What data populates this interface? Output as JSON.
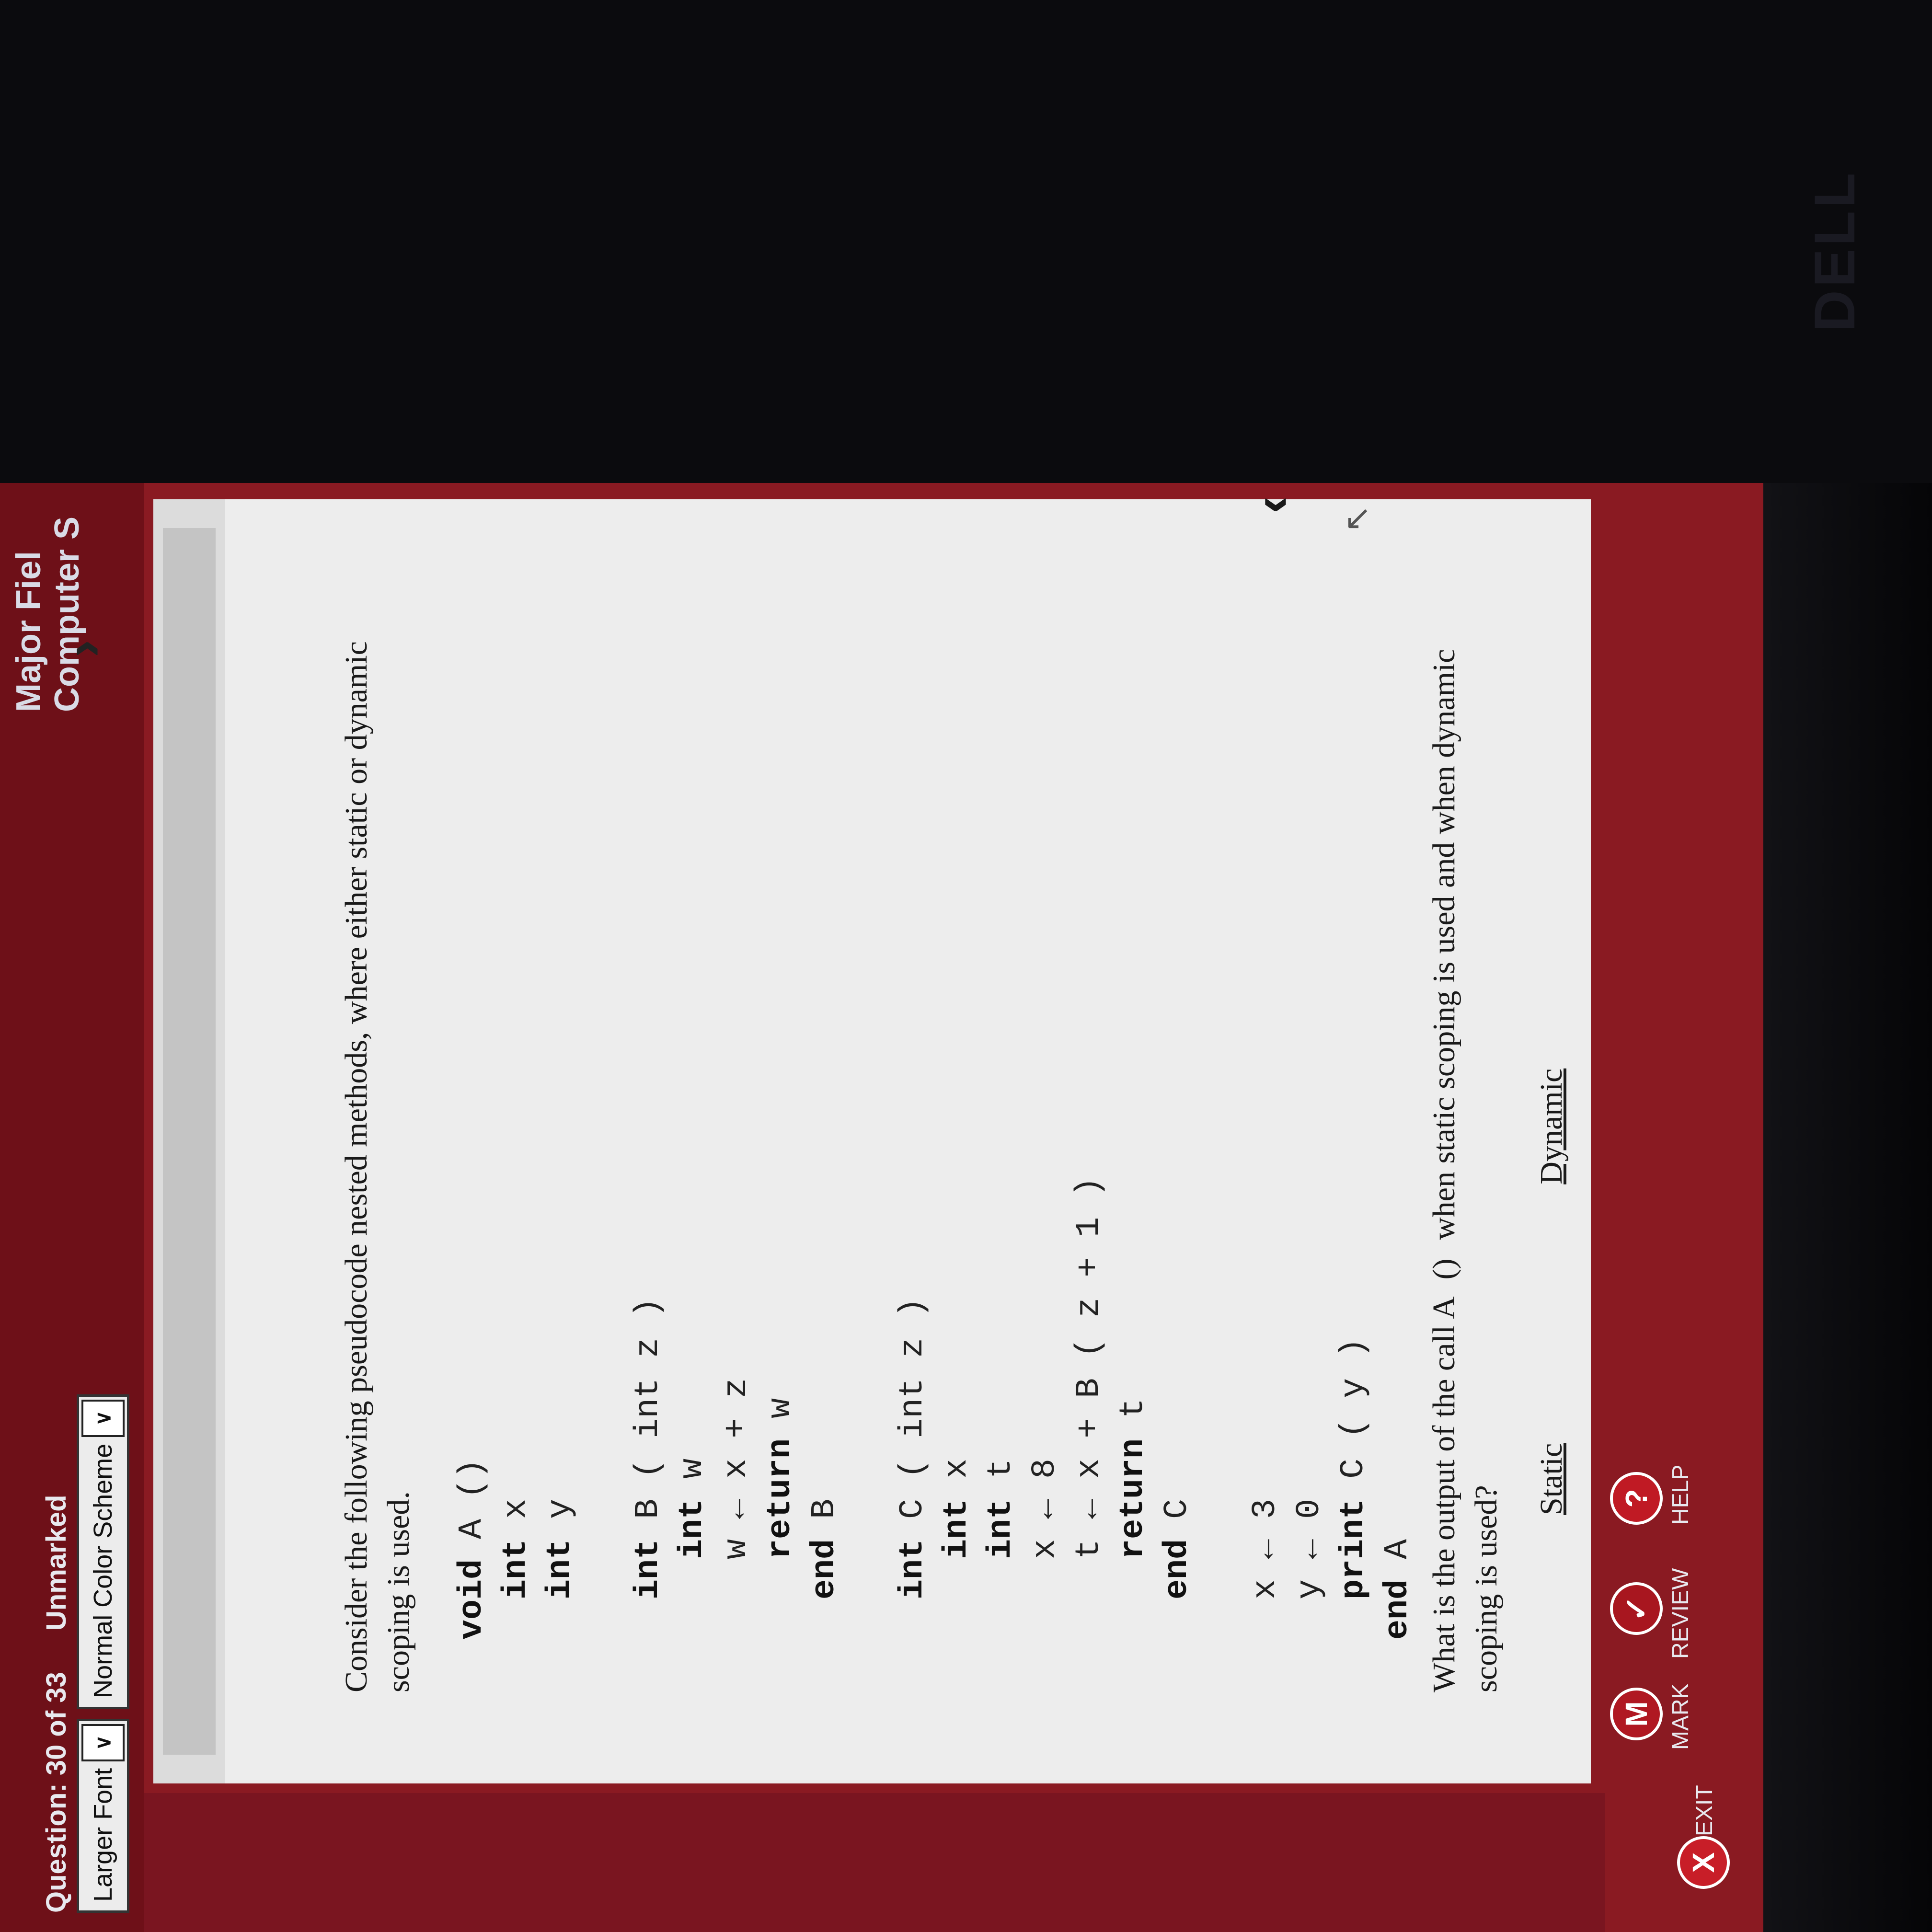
{
  "header": {
    "question_counter": "Question: 30 of 33",
    "mark_status": "Unmarked",
    "title_line1": "Major Fiel",
    "title_line2": "Computer S"
  },
  "toolbar": {
    "larger_font_label": "Larger Font",
    "color_scheme_label": "Normal Color Scheme"
  },
  "question": {
    "intro": "Consider the following pseudocode nested methods, where either static or dynamic scoping is used.",
    "code": [
      {
        "kw": "void",
        "rest": " A ()"
      },
      {
        "kw": "  int",
        "rest": " x"
      },
      {
        "kw": "  int",
        "rest": " y"
      },
      {
        "kw": "",
        "rest": ""
      },
      {
        "kw": "  int",
        "rest": " B ( int z )"
      },
      {
        "kw": "    int",
        "rest": " w"
      },
      {
        "kw": "",
        "rest": "    w ← x + z"
      },
      {
        "kw": "    return",
        "rest": " w"
      },
      {
        "kw": "  end",
        "rest": " B"
      },
      {
        "kw": "",
        "rest": ""
      },
      {
        "kw": "  int",
        "rest": " C ( int z )"
      },
      {
        "kw": "    int",
        "rest": " x"
      },
      {
        "kw": "    int",
        "rest": " t"
      },
      {
        "kw": "",
        "rest": "    x ← 8"
      },
      {
        "kw": "",
        "rest": "    t ← x + B ( z + 1 )"
      },
      {
        "kw": "    return",
        "rest": " t"
      },
      {
        "kw": "  end",
        "rest": " C"
      },
      {
        "kw": "",
        "rest": ""
      },
      {
        "kw": "",
        "rest": "  x ← 3"
      },
      {
        "kw": "",
        "rest": "  y ← 0"
      },
      {
        "kw": "  print",
        "rest": " C ( y )"
      },
      {
        "kw": "end",
        "rest": " A"
      }
    ],
    "prompt_part1": "What is the output of the call A",
    "prompt_blank": "()",
    "prompt_part2": "when static scoping is used and when dynamic scoping is used?",
    "answer_static": "Static",
    "answer_dynamic": "Dynamic"
  },
  "nav": {
    "exit_label": "EXIT",
    "exit_glyph": "X",
    "mark_label": "MARK",
    "mark_glyph": "M",
    "review_label": "REVIEW",
    "review_glyph": "✓",
    "help_label": "HELP",
    "help_glyph": "?",
    "prev_glyph": "‹",
    "next_glyph": "›"
  },
  "colors": {
    "frame": "#8a1a22",
    "exit": "#c81e28",
    "mark": "#b01822",
    "review": "#a8161f",
    "help": "#c01a24"
  },
  "monitor_brand": "DELL"
}
